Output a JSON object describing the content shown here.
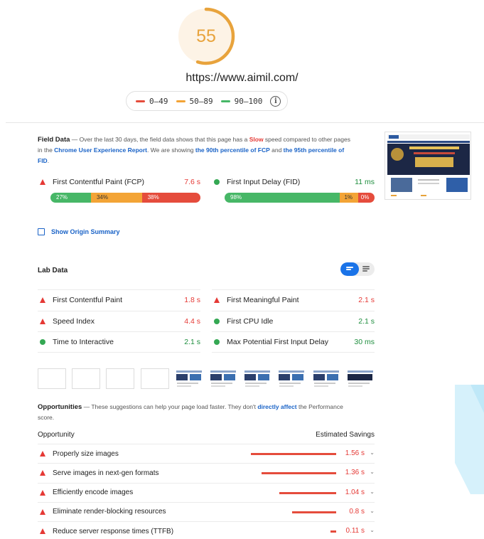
{
  "score": {
    "value": "55",
    "fraction": 0.55,
    "color": "#e8a33c",
    "track_color": "#fdf3e6"
  },
  "url": "https://www.aimil.com/",
  "legend": [
    {
      "label": "0–49",
      "color": "#e54c3c"
    },
    {
      "label": "50–89",
      "color": "#f3a436"
    },
    {
      "label": "90–100",
      "color": "#47b767"
    }
  ],
  "legend_info_icon": "info-icon",
  "field": {
    "title": "Field Data",
    "desc_1": " — Over the last 30 days, the field data shows that this page has a ",
    "slow": "Slow",
    "desc_2": " speed compared to other pages in the ",
    "crux_link": "Chrome User Experience Report",
    "desc_3": ". We are showing ",
    "fcp_link": "the 90th percentile of FCP",
    "desc_4": " and ",
    "fid_link": "the 95th percentile of FID",
    "desc_5": ".",
    "metrics": [
      {
        "label": "First Contentful Paint (FCP)",
        "value": "7.6 s",
        "status": "red",
        "distribution": [
          {
            "label": "27%",
            "share": 0.27,
            "kind": "g"
          },
          {
            "label": "34%",
            "share": 0.34,
            "kind": "o"
          },
          {
            "label": "38%",
            "share": 0.39,
            "kind": "r"
          }
        ]
      },
      {
        "label": "First Input Delay (FID)",
        "value": "11 ms",
        "status": "green",
        "distribution": [
          {
            "label": "98%",
            "share": 0.77,
            "kind": "g"
          },
          {
            "label": "1%",
            "share": 0.12,
            "kind": "o"
          },
          {
            "label": "0%",
            "share": 0.11,
            "kind": "r"
          }
        ]
      }
    ]
  },
  "origin_summary": "Show Origin Summary",
  "lab": {
    "title": "Lab Data",
    "metrics": [
      {
        "label": "First Contentful Paint",
        "value": "1.8 s",
        "status": "red"
      },
      {
        "label": "First Meaningful Paint",
        "value": "2.1 s",
        "status": "red"
      },
      {
        "label": "Speed Index",
        "value": "4.4 s",
        "status": "red"
      },
      {
        "label": "First CPU Idle",
        "value": "2.1 s",
        "status": "green"
      },
      {
        "label": "Time to Interactive",
        "value": "2.1 s",
        "status": "green"
      },
      {
        "label": "Max Potential First Input Delay",
        "value": "30 ms",
        "status": "green"
      }
    ]
  },
  "filmstrip": {
    "frame_count": 10,
    "blank_frames": 4
  },
  "opportunities": {
    "title": "Opportunities",
    "desc_1": " — These suggestions can help your page load faster. They don't ",
    "link": "directly affect",
    "desc_2": " the Performance score.",
    "col_left": "Opportunity",
    "col_right": "Estimated Savings",
    "items": [
      {
        "label": "Properly size images",
        "value": "1.56 s",
        "seconds": 1.56
      },
      {
        "label": "Serve images in next-gen formats",
        "value": "1.36 s",
        "seconds": 1.36
      },
      {
        "label": "Efficiently encode images",
        "value": "1.04 s",
        "seconds": 1.04
      },
      {
        "label": "Eliminate render-blocking resources",
        "value": "0.8 s",
        "seconds": 0.8
      },
      {
        "label": "Reduce server response times (TTFB)",
        "value": "0.11 s",
        "seconds": 0.11
      }
    ]
  },
  "colors": {
    "red": "#e53935",
    "green": "#1e8e3e",
    "link": "#1a63c7",
    "toggle": "#1a73e8"
  }
}
